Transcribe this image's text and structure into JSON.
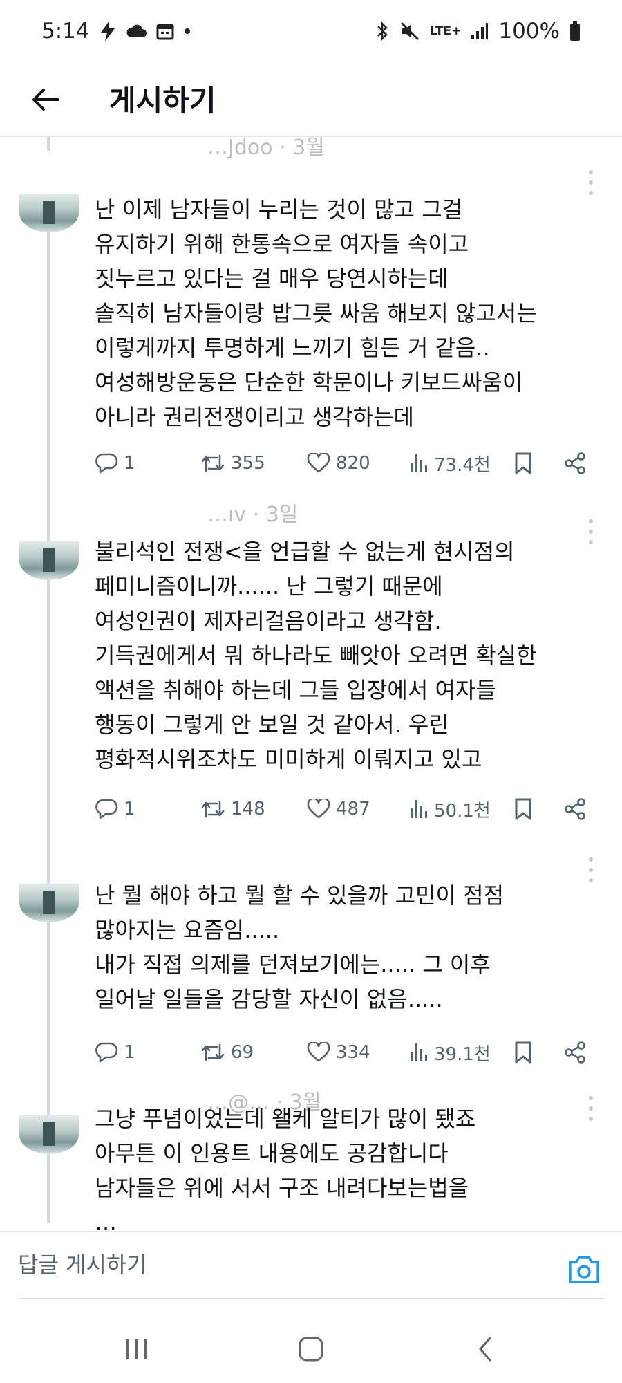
{
  "status_bar": {
    "time": "5:14",
    "battery": "100%",
    "network": "LTE+"
  },
  "header": {
    "title": "게시하기"
  },
  "replies": [
    {
      "handle": "…Jdoo · 3월",
      "lines": [
        "난 이제 남자들이 누리는 것이 많고 그걸",
        "유지하기 위해 한통속으로 여자들 속이고",
        "짓누르고 있다는 걸 매우 당연시하는데",
        "솔직히 남자들이랑 밥그릇 싸움 해보지 않고서는",
        "이렇게까지 투명하게 느끼기 힘든 거 같음..",
        "여성해방운동은 단순한 학문이나 키보드싸움이",
        "아니라 권리전쟁이리고 생각하는데"
      ],
      "stats": {
        "replies": "1",
        "retweets": "355",
        "likes": "820",
        "views": "73.4천"
      }
    },
    {
      "handle": "…ıv · 3일",
      "lines": [
        "불리석인 전쟁<을 언급할 수 없는게 현시점의",
        "페미니즘이니까...... 난 그렇기 때문에",
        "여성인권이 제자리걸음이라고 생각함.",
        "기득권에게서 뭐 하나라도 빼앗아 오려면 확실한",
        "액션을 취해야 하는데 그들 입장에서 여자들",
        "행동이 그렇게 안 보일 것 같아서. 우린",
        "평화적시위조차도 미미하게 이뤄지고 있고"
      ],
      "stats": {
        "replies": "1",
        "retweets": "148",
        "likes": "487",
        "views": "50.1천"
      }
    },
    {
      "handle": "",
      "lines": [
        "난 뭘 해야 하고 뭘 할 수 있을까 고민이 점점",
        "많아지는 요즘임.....",
        "내가 직접 의제를 던져보기에는..... 그 이후",
        "일어날 일들을 감당할 자신이 없음....."
      ],
      "stats": {
        "replies": "1",
        "retweets": "69",
        "likes": "334",
        "views": "39.1천"
      }
    },
    {
      "handle": "…@… · 3월",
      "lines": [
        "그냥 푸념이었는데 왤케 알티가 많이 됐죠",
        "아무튼 이 인용트 내용에도 공감합니다",
        "남자들은 위에 서서 구조 내려다보는법을",
        "…"
      ]
    }
  ],
  "composer": {
    "placeholder": "답글 게시하기"
  },
  "icons": {
    "back": "arrow-left-icon",
    "more": "vertical-dots-icon",
    "reply": "speech-bubble-icon",
    "retweet": "retweet-icon",
    "like": "heart-icon",
    "views": "bar-chart-icon",
    "bookmark": "bookmark-icon",
    "share": "share-icon",
    "camera": "camera-icon"
  },
  "colors": {
    "accent": "#1d9bf0",
    "muted": "#536471",
    "text": "#0f1419",
    "thread_line": "#cfd9de"
  }
}
